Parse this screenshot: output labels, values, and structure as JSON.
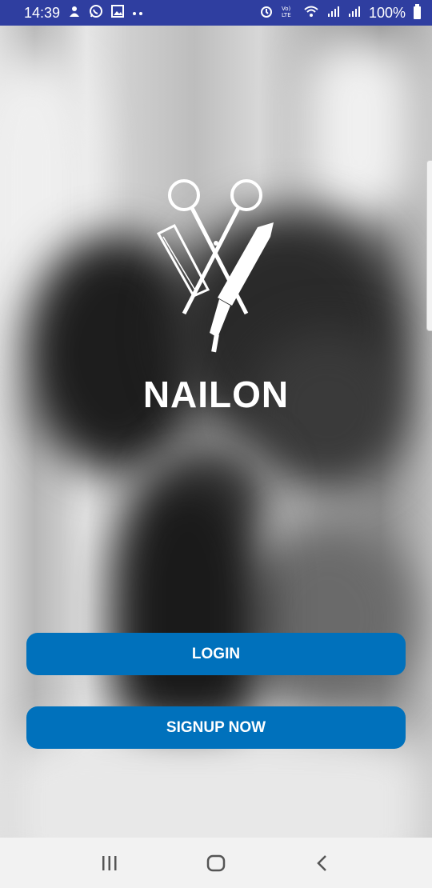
{
  "status_bar": {
    "time": "14:39",
    "battery_text": "100%",
    "left_icons": [
      "notification-icon",
      "whatsapp-icon",
      "image-icon",
      "more-dots-icon"
    ],
    "right_icons": [
      "alarm-icon",
      "volte-icon",
      "wifi-icon",
      "signal-icon",
      "signal-icon",
      "battery-icon"
    ],
    "background_color": "#2f3ea0"
  },
  "app": {
    "title": "NAILON",
    "logo_icon": "scissors-razor-logo-icon"
  },
  "buttons": {
    "login_label": "LOGIN",
    "signup_label": "SIGNUP NOW",
    "color": "#0071bc"
  },
  "nav_bar": {
    "items": [
      "recent-apps-icon",
      "home-icon",
      "back-icon"
    ]
  }
}
